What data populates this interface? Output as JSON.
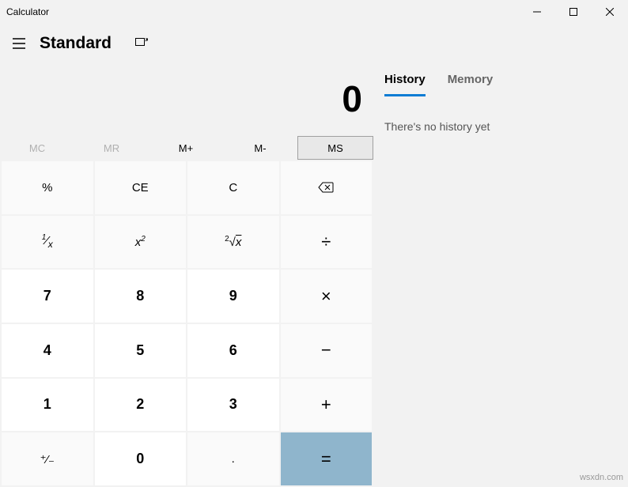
{
  "titlebar": {
    "title": "Calculator"
  },
  "header": {
    "mode": "Standard"
  },
  "display": {
    "value": "0"
  },
  "memory": {
    "mc": "MC",
    "mr": "MR",
    "mplus": "M+",
    "mminus": "M-",
    "ms": "MS"
  },
  "keys": {
    "percent": "%",
    "ce": "CE",
    "c": "C",
    "reciprocal": "¹⁄ₓ",
    "square": "x²",
    "sqrt": "²√x",
    "divide": "÷",
    "multiply": "×",
    "minus": "−",
    "plus": "+",
    "equals": "=",
    "sign": "⁺⁄₋",
    "decimal": ".",
    "n0": "0",
    "n1": "1",
    "n2": "2",
    "n3": "3",
    "n4": "4",
    "n5": "5",
    "n6": "6",
    "n7": "7",
    "n8": "8",
    "n9": "9"
  },
  "tabs": {
    "history": "History",
    "memory": "Memory"
  },
  "history": {
    "empty": "There's no history yet"
  },
  "watermark": "wsxdn.com"
}
